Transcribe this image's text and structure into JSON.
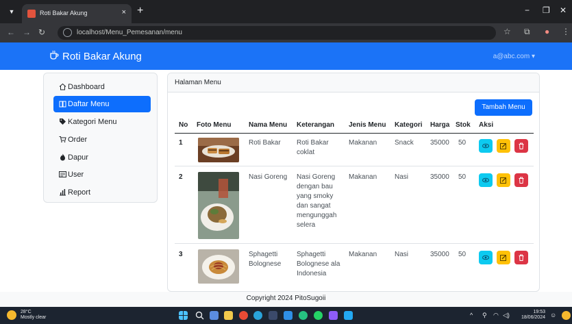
{
  "browser": {
    "tab_title": "Roti Bakar Akung",
    "tab_close": "×",
    "new_tab": "+",
    "url": "localhost/Menu_Pemesanan/menu",
    "minimize": "−",
    "restore": "❐",
    "close": "✕"
  },
  "navbar": {
    "brand": "Roti Bakar Akung",
    "user_email": "a@abc.com ▾"
  },
  "sidebar": {
    "items": [
      {
        "label": "Dashboard",
        "icon": "home-icon"
      },
      {
        "label": "Daftar Menu",
        "icon": "book-icon",
        "active": true
      },
      {
        "label": "Kategori Menu",
        "icon": "tag-icon"
      },
      {
        "label": "Order",
        "icon": "cart-icon"
      },
      {
        "label": "Dapur",
        "icon": "fire-icon"
      },
      {
        "label": "User",
        "icon": "user-card-icon"
      },
      {
        "label": "Report",
        "icon": "chart-icon"
      }
    ]
  },
  "card": {
    "title": "Halaman Menu",
    "add_button": "Tambah Menu",
    "columns": [
      "No",
      "Foto Menu",
      "Nama Menu",
      "Keterangan",
      "Jenis Menu",
      "Kategori",
      "Harga",
      "Stok",
      "Aksi"
    ],
    "rows": [
      {
        "no": "1",
        "nama": "Roti Bakar",
        "keterangan": "Roti Bakar coklat",
        "jenis": "Makanan",
        "kategori": "Snack",
        "harga": "35000",
        "stok": "50"
      },
      {
        "no": "2",
        "nama": "Nasi Goreng",
        "keterangan": "Nasi Goreng dengan bau yang smoky dan sangat mengunggah selera",
        "jenis": "Makanan",
        "kategori": "Nasi",
        "harga": "35000",
        "stok": "50"
      },
      {
        "no": "3",
        "nama": "Sphagetti Bolognese",
        "keterangan": "Sphagetti Bolognese ala Indonesia",
        "jenis": "Makanan",
        "kategori": "Nasi",
        "harga": "35000",
        "stok": "50"
      }
    ]
  },
  "footer": {
    "text": "Copyright 2024 PitoSugoii"
  },
  "taskbar": {
    "temperature": "28°C",
    "weather": "Mostly clear",
    "time": "19:53",
    "date": "18/06/2024"
  },
  "colors": {
    "navbar": "#1b73f7",
    "primary": "#0d6efd",
    "info": "#0dcaf0",
    "warning": "#ffc107",
    "danger": "#dc3545"
  }
}
